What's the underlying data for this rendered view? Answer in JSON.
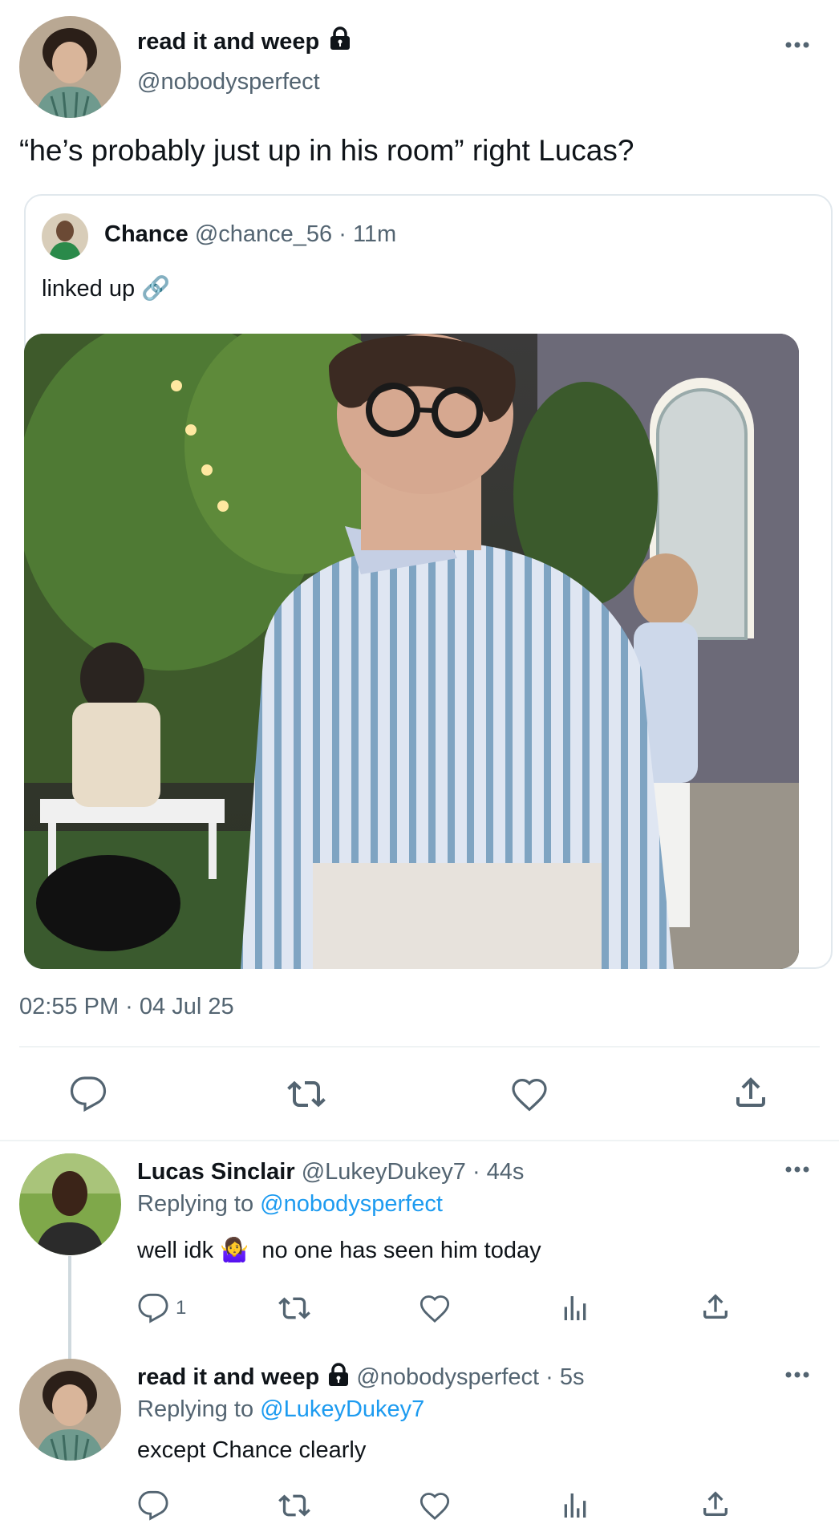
{
  "main_tweet": {
    "author_name": "read it and weep",
    "handle": "@nobodysperfect",
    "text": "“he’s probably just up in his room” right Lucas?",
    "timestamp": "02:55 PM · 04 Jul 25"
  },
  "quoted_tweet": {
    "author_name": "Chance",
    "handle": "@chance_56",
    "time": "· 11m",
    "text": "linked up 🔗"
  },
  "reply1": {
    "author_name": "Lucas Sinclair",
    "handle": "@LukeyDukey7",
    "time": "· 44s",
    "replying_label": "Replying to",
    "replying_to": "@nobodysperfect",
    "text": "well idk 🤷‍♀️  no one has seen him today",
    "reply_count": "1"
  },
  "reply2": {
    "author_name": "read it and weep",
    "handle": "@nobodysperfect",
    "time": "· 5s",
    "replying_label": "Replying to",
    "replying_to": "@LukeyDukey7",
    "text": "except Chance clearly"
  },
  "icons": [
    "lock-icon",
    "more-icon",
    "reply-icon",
    "retweet-icon",
    "like-icon",
    "share-icon",
    "views-icon",
    "link-emoji"
  ],
  "colors": {
    "accent": "#1d9bf0",
    "text": "#0f1419",
    "muted": "#536471",
    "divider": "#eff3f4"
  }
}
